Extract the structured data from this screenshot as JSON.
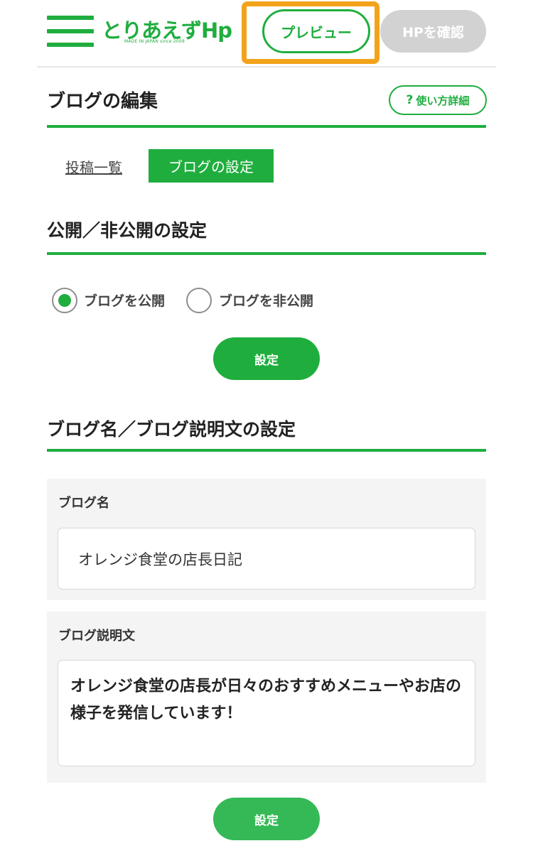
{
  "header": {
    "logo_text": "とりあえずHp",
    "logo_tagline": "MADE IN JAPAN since 2009",
    "preview_label": "プレビュー",
    "check_hp_label": "HPを確認"
  },
  "page": {
    "title": "ブログの編集",
    "help_label": "使い方詳細",
    "help_icon": "?"
  },
  "tabs": {
    "list_label": "投稿一覧",
    "settings_label": "ブログの設定"
  },
  "visibility": {
    "heading": "公開／非公開の設定",
    "option_public": "ブログを公開",
    "option_private": "ブログを非公開",
    "selected": "public",
    "submit_label": "設定"
  },
  "blog_info": {
    "heading": "ブログ名／ブログ説明文の設定",
    "name_label": "ブログ名",
    "name_value": "オレンジ食堂の店長日記",
    "description_label": "ブログ説明文",
    "description_value": "オレンジ食堂の店長が日々のおすすめメニューやお店の様子を発信しています！",
    "submit_label": "設定"
  },
  "colors": {
    "accent": "#1fae3e",
    "highlight": "#f3a31b",
    "disabled": "#d2d2d2"
  }
}
